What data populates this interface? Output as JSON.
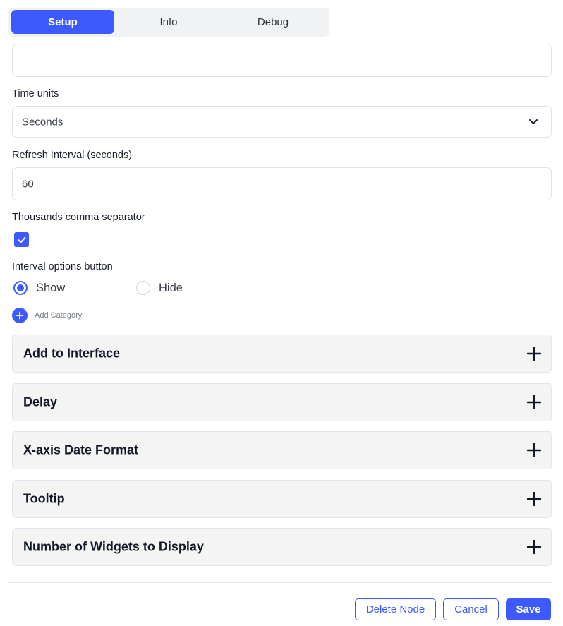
{
  "tabs": [
    {
      "label": "Setup",
      "active": true
    },
    {
      "label": "Info",
      "active": false
    },
    {
      "label": "Debug",
      "active": false
    }
  ],
  "top_field": {
    "value": ""
  },
  "time_units": {
    "label": "Time units",
    "selected": "Seconds"
  },
  "refresh_interval": {
    "label": "Refresh Interval (seconds)",
    "value": "60"
  },
  "thousands_separator": {
    "label": "Thousands comma separator",
    "checked": true
  },
  "interval_options": {
    "label": "Interval options button",
    "options": [
      {
        "label": "Show",
        "checked": true
      },
      {
        "label": "Hide",
        "checked": false
      }
    ]
  },
  "add_category": {
    "label": "Add Category"
  },
  "sections": [
    {
      "title": "Add to Interface"
    },
    {
      "title": "Delay"
    },
    {
      "title": "X-axis Date Format"
    },
    {
      "title": "Tooltip"
    },
    {
      "title": "Number of Widgets to Display"
    }
  ],
  "footer": {
    "delete_label": "Delete Node",
    "cancel_label": "Cancel",
    "save_label": "Save"
  },
  "colors": {
    "accent": "#3d5afe",
    "section_bg": "#f4f4f5"
  }
}
